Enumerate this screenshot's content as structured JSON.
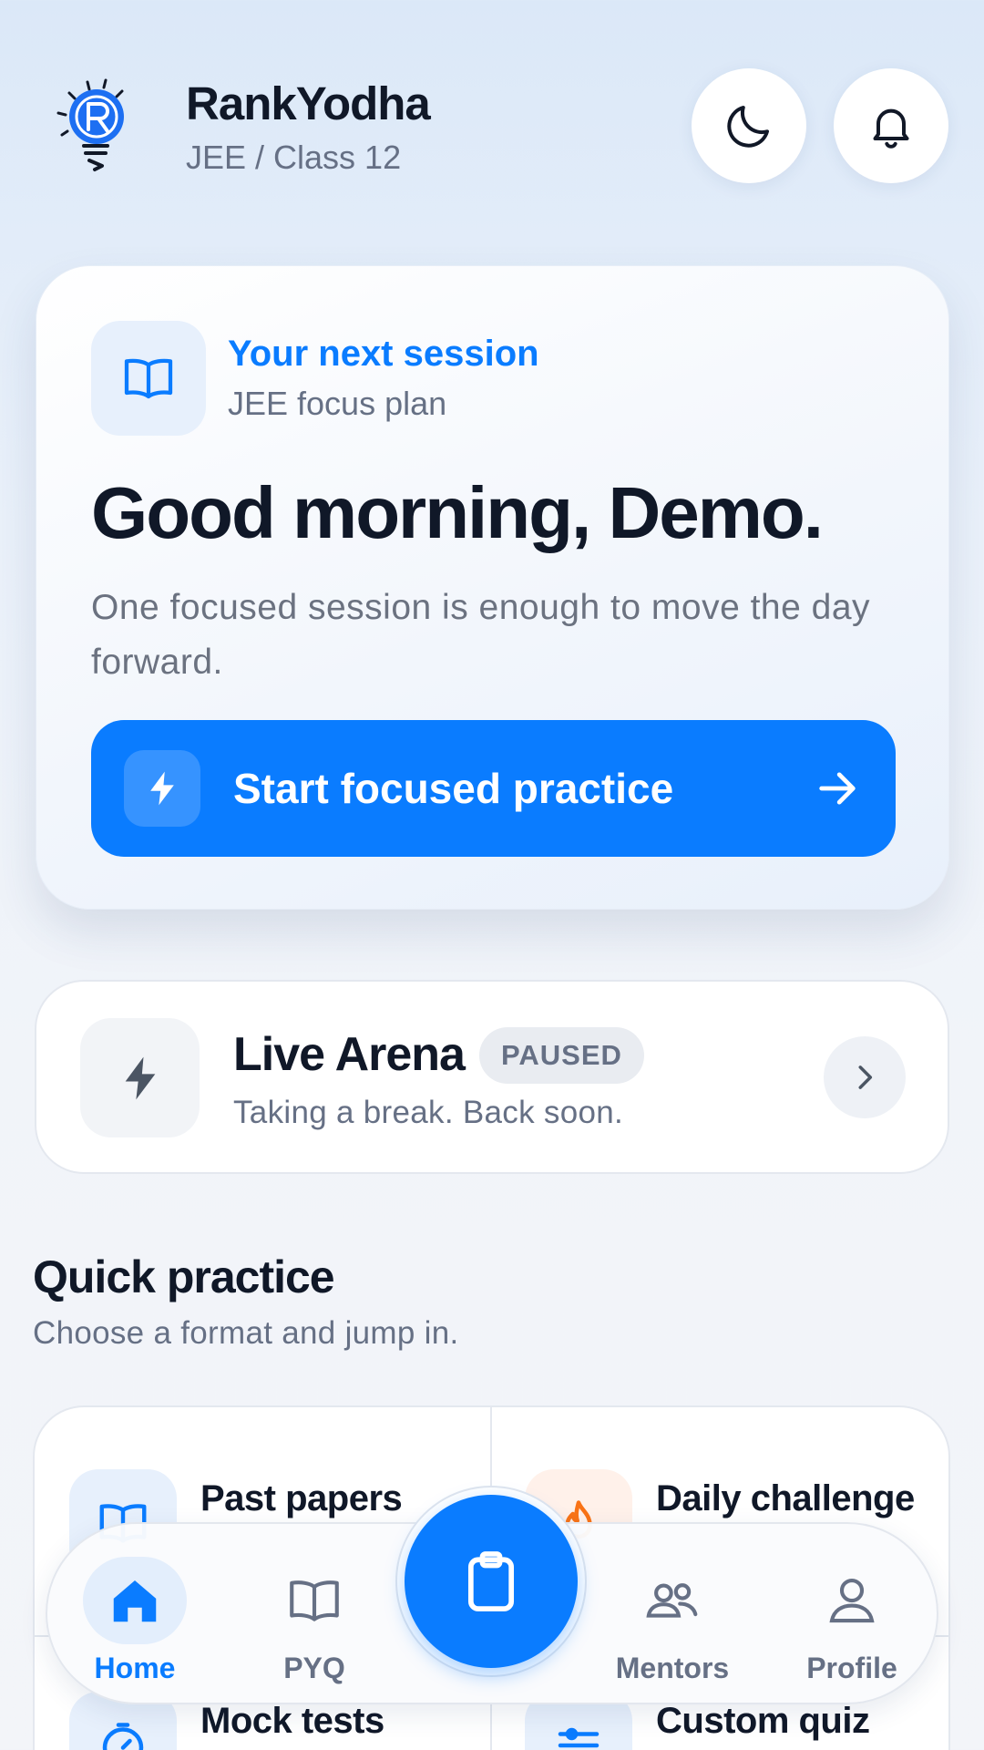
{
  "header": {
    "brand_name": "RankYodha",
    "brand_subtitle": "JEE / Class 12",
    "logo_icon": "bulb-r-logo",
    "theme_toggle_icon": "moon-icon",
    "notifications_icon": "bell-icon"
  },
  "hero": {
    "icon": "book-icon",
    "kicker": "Your next session",
    "plan": "JEE focus plan",
    "greeting": "Good morning, Demo.",
    "description": "One focused session is enough to move the day forward.",
    "cta_label": "Start focused practice",
    "cta_icon": "bolt-icon",
    "cta_arrow_icon": "arrow-right-icon"
  },
  "arena": {
    "icon": "bolt-icon",
    "title": "Live Arena",
    "badge": "PAUSED",
    "subtitle": "Taking a break. Back soon.",
    "chevron_icon": "chevron-right-icon"
  },
  "quick_practice": {
    "title": "Quick practice",
    "subtitle": "Choose a format and jump in.",
    "tiles": [
      {
        "label": "Past papers",
        "icon": "book-icon"
      },
      {
        "label": "Daily challenge",
        "icon": "flame-icon"
      },
      {
        "label": "Mock tests",
        "icon": "timer-icon"
      },
      {
        "label": "Custom quiz",
        "icon": "sliders-icon"
      }
    ]
  },
  "bottom_nav": {
    "items": [
      {
        "label": "Home",
        "icon": "home-icon",
        "active": true
      },
      {
        "label": "PYQ",
        "icon": "book-icon"
      },
      {
        "label": "Mentors",
        "icon": "users-icon"
      },
      {
        "label": "Profile",
        "icon": "user-icon"
      }
    ],
    "center_icon": "clipboard-icon"
  },
  "colors": {
    "accent": "#0a7cff",
    "text_primary": "#101828",
    "text_secondary": "#667085",
    "flame": "#f97316"
  }
}
